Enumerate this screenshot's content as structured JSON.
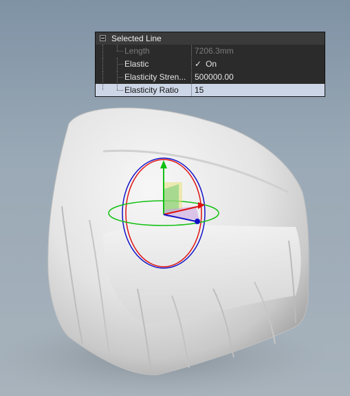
{
  "panel": {
    "header": "Selected Line",
    "rows": [
      {
        "label": "Length",
        "value": "7206.3mm"
      },
      {
        "label": "Elastic",
        "value": "On",
        "check": "✓"
      },
      {
        "label": "Elasticity Stren...",
        "value": "500000.00"
      },
      {
        "label": "Elasticity Ratio",
        "value": "15"
      }
    ]
  },
  "colors": {
    "gizmo_x": "#e01010",
    "gizmo_y": "#10c010",
    "gizmo_z": "#1010c8",
    "panel_bg": "#2b2b2b",
    "selected_row": "#cdd6e6"
  },
  "icons": [
    "collapse-minus-icon",
    "check-icon",
    "transform-gizmo"
  ]
}
